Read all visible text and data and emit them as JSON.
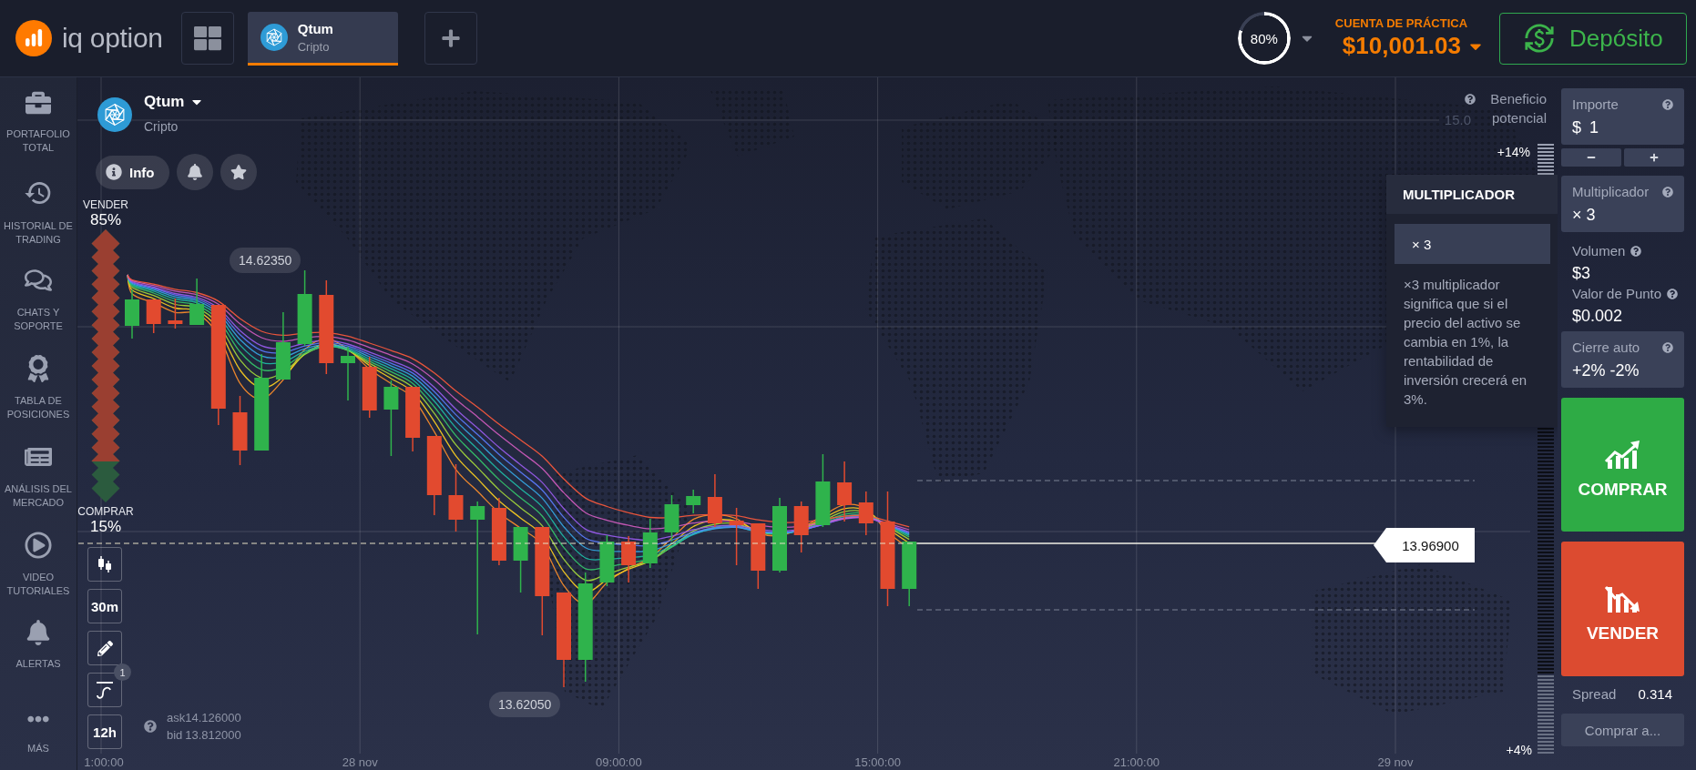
{
  "top_bar": {
    "logo": "iq option",
    "asset_tabs": [
      {
        "name": "Qtum",
        "category": "Cripto",
        "selected": true
      }
    ],
    "profit_ring": {
      "reading": "80%",
      "level": 0.8
    },
    "account": {
      "label": "CUENTA DE PRÁCTICA",
      "balance": "$10,001.03"
    },
    "deposit_button": "Depósito"
  },
  "sidebar": {
    "items": [
      {
        "label": "PORTAFOLIO TOTAL",
        "selected": false
      },
      {
        "label": "HISTORIAL DE TRADING",
        "selected": false
      },
      {
        "label": "CHATS Y SOPORTE",
        "selected": false
      },
      {
        "label": "TABLA DE POSICIONES",
        "selected": false
      },
      {
        "label": "ANÁLISIS DEL MERCADO",
        "selected": false
      },
      {
        "label": "VIDEO TUTORIALES",
        "selected": false
      },
      {
        "label": "ALERTAS",
        "selected": false
      },
      {
        "label": "MÁS",
        "selected": false
      }
    ]
  },
  "chart": {
    "asset": {
      "name": "Qtum",
      "category": "Cripto"
    },
    "info_button": "Info",
    "profit_scale": {
      "label": "Beneficio potencial",
      "top": "+14%",
      "bottom": "+4%"
    },
    "y_tick": "15.0",
    "sentiment": {
      "sell_label": "VENDER",
      "sell_reading": "85%",
      "buy_label": "COMPRAR",
      "buy_reading": "15%",
      "level": 0.85
    },
    "high_label": "14.62350",
    "low_label": "13.62050",
    "current_price": "13.96900",
    "tools": [
      {
        "kind": "chart_type"
      },
      {
        "kind": "timeframe",
        "label": "30m"
      },
      {
        "kind": "drawing"
      },
      {
        "kind": "indicators",
        "badge": "1"
      },
      {
        "kind": "timeframe",
        "label": "12h"
      }
    ],
    "quote": {
      "ask_label": "ask",
      "ask": "14.126000",
      "bid_label": "bid",
      "bid": "13.812000"
    },
    "x_axis": [
      "1:00:00",
      "28 nov",
      "09:00:00",
      "15:00:00",
      "21:00:00",
      "29 nov"
    ]
  },
  "multiplier_tooltip": {
    "title": "MULTIPLICADOR",
    "option": "× 3",
    "description": "×3 multiplicador significa que si el precio del activo se cambia en 1%, la rentabilidad de inversión crecerá en 3%."
  },
  "trade_panel": {
    "amount": {
      "label": "Importe",
      "currency": "$",
      "value": "1"
    },
    "multiplier": {
      "label": "Multiplicador",
      "value": "× 3"
    },
    "volume": {
      "label": "Volumen",
      "value": "$3"
    },
    "point_value": {
      "label": "Valor de Punto",
      "value": "$0.002"
    },
    "auto_close": {
      "label": "Cierre auto",
      "value": "+2% -2%"
    },
    "buy_button": "COMPRAR",
    "sell_button": "VENDER",
    "spread": {
      "label": "Spread",
      "value": "0.314"
    },
    "buy_at_button": "Comprar a..."
  }
}
